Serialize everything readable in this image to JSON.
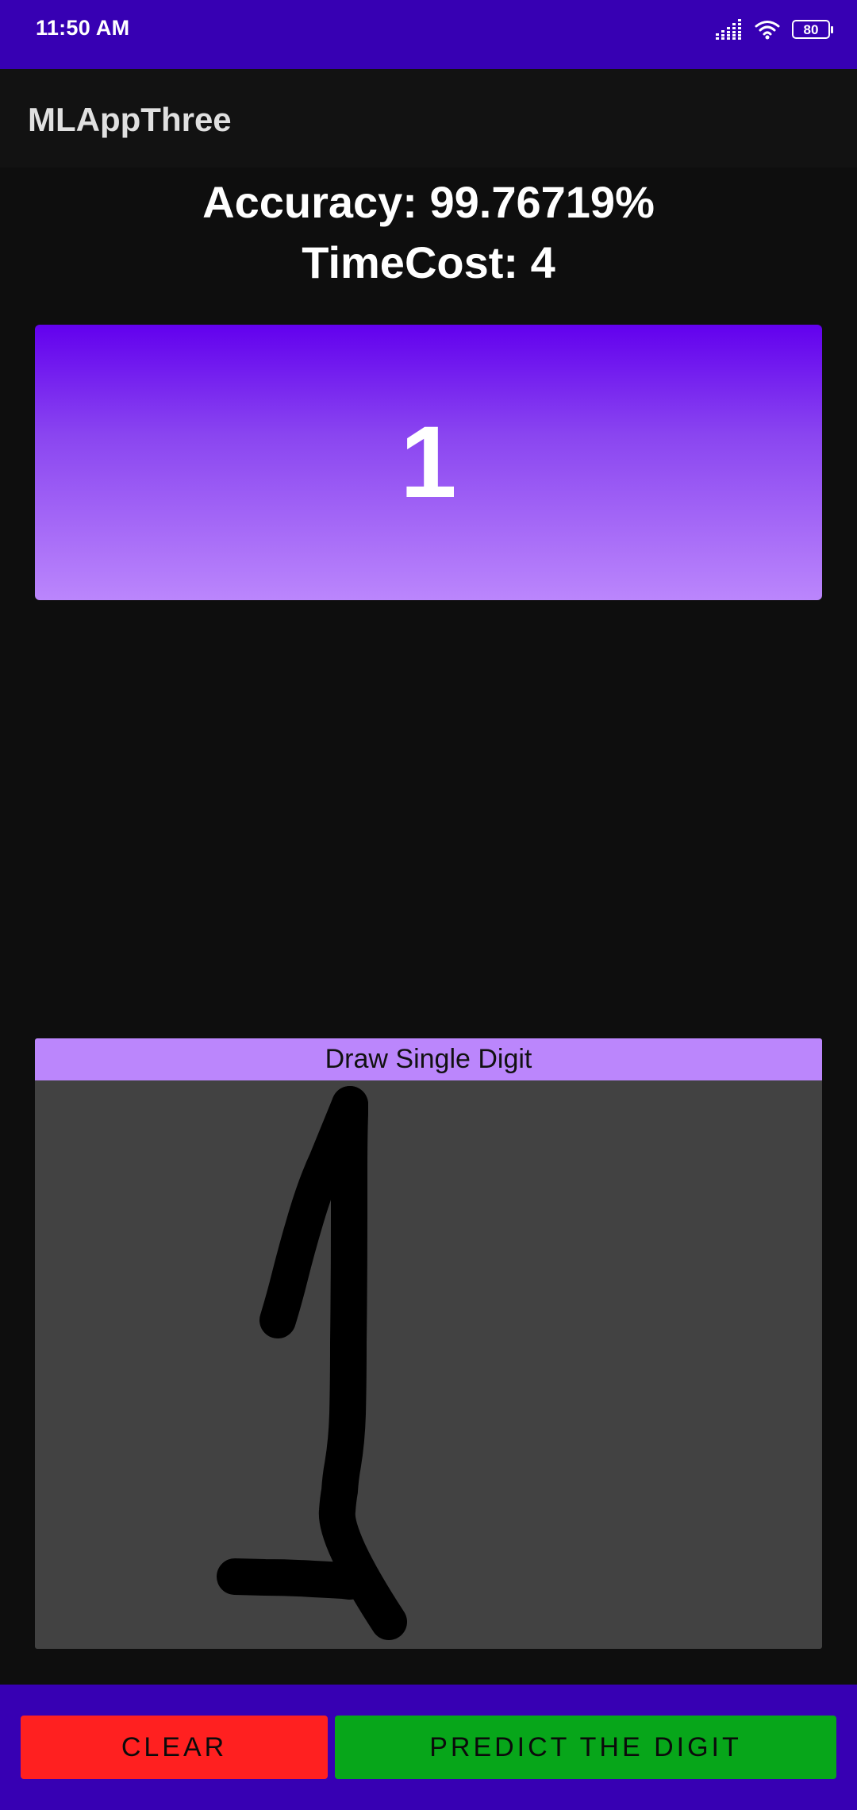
{
  "status_bar": {
    "time": "11:50 AM",
    "battery_level": "80",
    "icons": [
      "signal-icon",
      "wifi-icon",
      "battery-icon"
    ]
  },
  "app_bar": {
    "title": "MLAppThree"
  },
  "results": {
    "accuracy_text": "Accuracy: 99.76719%",
    "timecost_text": "TimeCost: 4",
    "predicted_digit": "1"
  },
  "canvas": {
    "header": "Draw Single Digit",
    "stroke_color": "#000000",
    "background_color": "#424242"
  },
  "buttons": {
    "clear_label": "CLEAR",
    "predict_label": "PREDICT THE DIGIT"
  },
  "colors": {
    "primary_dark": "#3700b3",
    "primary": "#6200ee",
    "accent": "#bb86fc",
    "clear_button": "#ff2020",
    "predict_button": "#07a61a",
    "background": "#0e0e0e"
  }
}
